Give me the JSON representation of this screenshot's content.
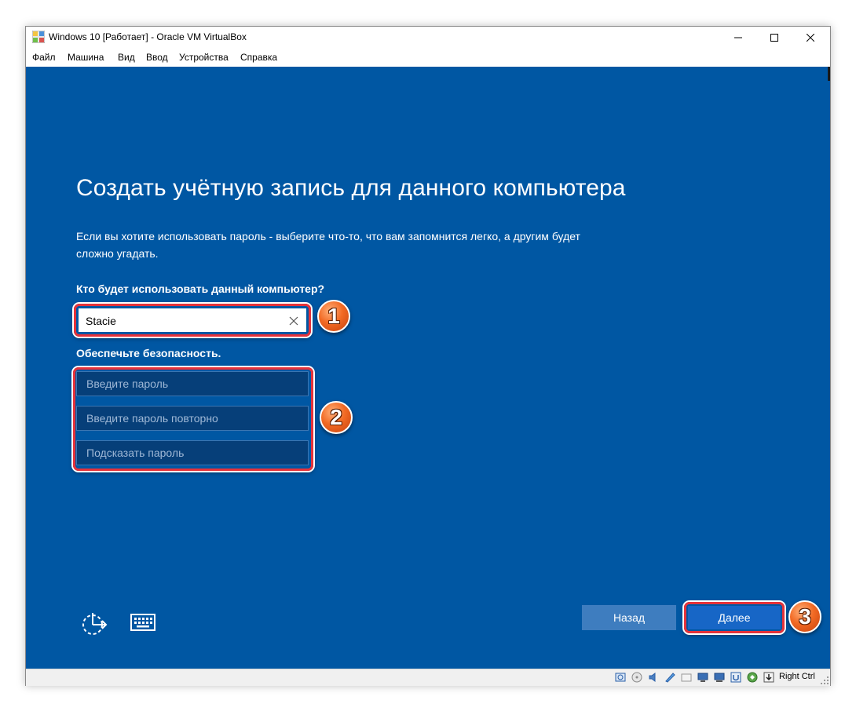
{
  "window": {
    "title": "Windows 10 [Работает] - Oracle VM VirtualBox",
    "app_icon": "virtualbox-icon",
    "controls": [
      "minimize-icon",
      "maximize-icon",
      "close-icon"
    ]
  },
  "menubar": {
    "items": [
      "Файл",
      "Машина",
      "Вид",
      "Ввод",
      "Устройства",
      "Справка"
    ]
  },
  "setup": {
    "heading": "Создать учётную запись для данного компьютера",
    "description": "Если вы хотите использовать пароль - выберите что-то, что вам запомнится легко, а другим будет сложно угадать.",
    "question_label": "Кто будет использовать данный компьютер?",
    "username_value": "Stacie",
    "security_label": "Обеспечьте безопасность.",
    "password_placeholder": "Введите пароль",
    "password_repeat_placeholder": "Введите пароль повторно",
    "password_hint_placeholder": "Подсказать пароль",
    "back_label": "Назад",
    "next_label": "Далее",
    "accessibility_icon": "ease-of-access-icon",
    "keyboard_icon": "keyboard-icon"
  },
  "annotations": {
    "badge_1": "1",
    "badge_2": "2",
    "badge_3": "3",
    "highlight_color": "#e5323a",
    "badge_color": "#f26a24"
  },
  "statusbar": {
    "host_key": "Right Ctrl",
    "icons": [
      "hard-disk-icon",
      "optical-disk-icon",
      "audio-icon",
      "network-icon",
      "usb-icon",
      "shared-folders-icon",
      "display-icon",
      "video-capture-icon",
      "vrde-icon",
      "cpu-icon",
      "mouse-integration-icon"
    ]
  },
  "colors": {
    "oobe_background": "#0057a3",
    "field_background": "#063f79",
    "back_button": "#3e7dbf",
    "next_button": "#1766c6"
  }
}
